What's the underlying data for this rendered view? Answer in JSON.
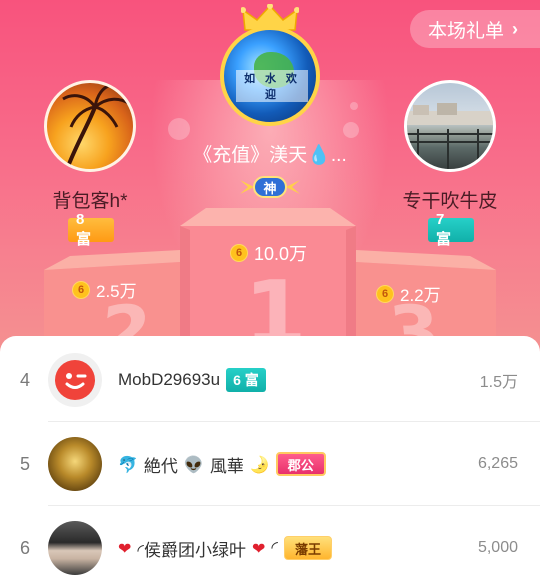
{
  "header": {
    "gift_list_label": "本场礼单",
    "gift_list_chevron": "›"
  },
  "podium": {
    "first": {
      "name": "《充值》渼天💧...",
      "badge": "神",
      "score": "10.0万",
      "rank_digit": "1",
      "avatar_text": "如 水 欢 迎"
    },
    "second": {
      "name": "背包客h*",
      "rich_level": "8 富",
      "score": "2.5万",
      "rank_digit": "2"
    },
    "third": {
      "name": "专干吹牛皮",
      "rich_level": "7 富",
      "score": "2.2万",
      "rank_digit": "3"
    }
  },
  "coin_symbol": "6",
  "list": [
    {
      "rank": "4",
      "name": "MobD29693u",
      "rich_level": "6 富",
      "score": "1.5万"
    },
    {
      "rank": "5",
      "name_parts": [
        "🐬",
        "絶代",
        "👽",
        "風華",
        "🌛"
      ],
      "title": "郡公",
      "score": "6,265"
    },
    {
      "rank": "6",
      "name_parts": [
        "❤",
        "◜侯爵团小绿叶",
        "❤",
        "◜"
      ],
      "title": "藩王",
      "score": "5,000"
    }
  ],
  "colors": {
    "hero_top": "#f8537d",
    "rich_orange": "#ff9a14",
    "rich_teal": "#11b0a9",
    "crown_gold": "#ffd447"
  }
}
